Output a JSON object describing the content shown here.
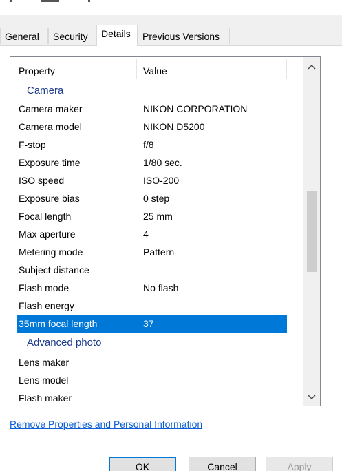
{
  "tabs": [
    {
      "label": "General",
      "active": false
    },
    {
      "label": "Security",
      "active": false
    },
    {
      "label": "Details",
      "active": true
    },
    {
      "label": "Previous Versions",
      "active": false
    }
  ],
  "columns": {
    "property": "Property",
    "value": "Value"
  },
  "groups": {
    "camera": "Camera",
    "advanced_photo": "Advanced photo"
  },
  "camera_rows": [
    {
      "property": "Camera maker",
      "value": "NIKON CORPORATION"
    },
    {
      "property": "Camera model",
      "value": "NIKON D5200"
    },
    {
      "property": "F-stop",
      "value": "f/8"
    },
    {
      "property": "Exposure time",
      "value": "1/80 sec."
    },
    {
      "property": "ISO speed",
      "value": "ISO-200"
    },
    {
      "property": "Exposure bias",
      "value": "0 step"
    },
    {
      "property": "Focal length",
      "value": "25 mm"
    },
    {
      "property": "Max aperture",
      "value": "4"
    },
    {
      "property": "Metering mode",
      "value": "Pattern"
    },
    {
      "property": "Subject distance",
      "value": ""
    },
    {
      "property": "Flash mode",
      "value": "No flash"
    },
    {
      "property": "Flash energy",
      "value": ""
    },
    {
      "property": "35mm focal length",
      "value": "37",
      "selected": true
    }
  ],
  "advanced_rows": [
    {
      "property": "Lens maker",
      "value": ""
    },
    {
      "property": "Lens model",
      "value": ""
    },
    {
      "property": "Flash maker",
      "value": ""
    }
  ],
  "scrollbar": {
    "position_fraction": 0.5
  },
  "link_text": "Remove Properties and Personal Information",
  "buttons": {
    "ok": "OK",
    "cancel": "Cancel",
    "apply": "Apply",
    "apply_enabled": false
  },
  "colors": {
    "selection": "#0078d7",
    "group_header": "#1e3c8c",
    "link": "#0b5ed7"
  },
  "icons": {
    "scroll_up": "chevron-up-icon",
    "scroll_down": "chevron-down-icon"
  }
}
